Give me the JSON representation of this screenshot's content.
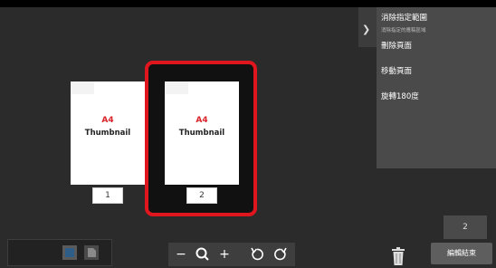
{
  "thumbnails": [
    {
      "size": "A4",
      "label": "Thumbnail",
      "page_number": "1",
      "selected": false
    },
    {
      "size": "A4",
      "label": "Thumbnail",
      "page_number": "2",
      "selected": true
    }
  ],
  "menu": {
    "deselect_title": "消除指定範圍",
    "deselect_sub": "消除指定的應稿區域",
    "delete_page": "刪除頁面",
    "move_page": "移動頁面",
    "rotate_180": "旋轉180度"
  },
  "page_count": "2",
  "end_edit_label": "編輯結束",
  "icons": {
    "collapse": "chevron-right-icon",
    "zoom_out": "minus-icon",
    "zoom": "magnifier-icon",
    "zoom_in": "plus-icon",
    "rotate_left": "rotate-left-icon",
    "rotate_right": "rotate-right-icon",
    "delete": "trash-icon",
    "view_thumbnail": "thumbnail-view-icon",
    "view_page": "page-view-icon"
  },
  "colors": {
    "selection": "#e0161f",
    "size_text": "#d9222a",
    "background": "#2b2b2b",
    "panel": "#4a4a4a"
  }
}
